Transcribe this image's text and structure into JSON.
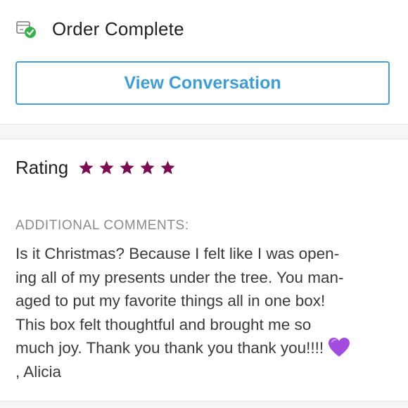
{
  "order": {
    "title": "Order Complete",
    "icon": "package-check-icon"
  },
  "actions": {
    "view_conversation": "View Conversation"
  },
  "rating": {
    "label": "Rating",
    "stars": 5,
    "max_stars": 5,
    "star_color": "#7d0b4f"
  },
  "comments": {
    "heading": "ADDITIONAL COMMENTS:",
    "lines": [
      "Is it Christmas? Because I felt like I was open-",
      "ing all of my presents under the tree. You man-",
      "aged to put my favorite things all in one box!",
      "This box felt thoughtful and brought me so",
      "much joy. Thank you thank you thank you!!!!",
      ", Alicia"
    ],
    "emoji": "purple-heart-icon"
  },
  "colors": {
    "accent": "#3f9dd6",
    "check_green": "#35b34a",
    "heart_purple": "#a24de0"
  }
}
